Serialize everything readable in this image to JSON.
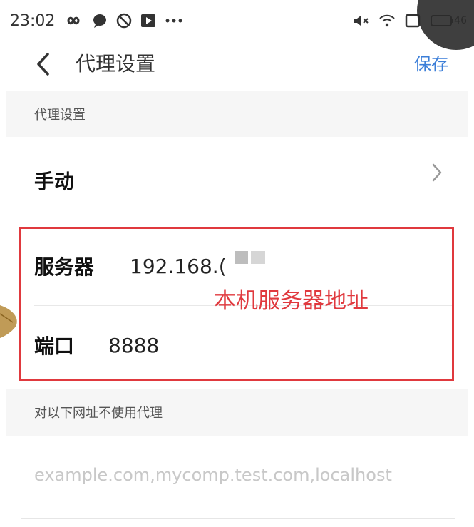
{
  "status_bar": {
    "time": "23:02",
    "battery_text": "46"
  },
  "header": {
    "title": "代理设置",
    "save_label": "保存"
  },
  "proxy_section": {
    "label": "代理设置"
  },
  "mode_row": {
    "value": "手动"
  },
  "server_row": {
    "label": "服务器",
    "value": "192.168.("
  },
  "port_row": {
    "label": "端口",
    "value": "8888"
  },
  "annotation": {
    "text": "本机服务器地址",
    "color": "#e0393e"
  },
  "bypass_section": {
    "label": "对以下网址不使用代理"
  },
  "bypass_field": {
    "placeholder": "example.com,mycomp.test.com,localhost"
  },
  "colors": {
    "accent": "#3b7ed8",
    "section_bg": "#f6f6f6"
  }
}
